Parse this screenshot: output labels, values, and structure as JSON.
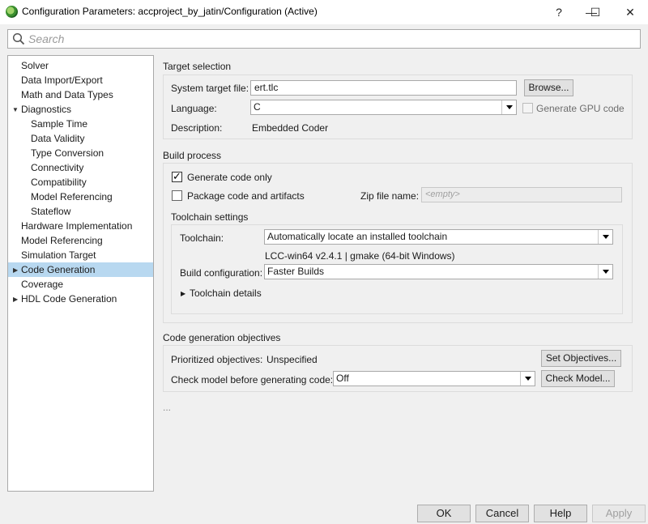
{
  "window": {
    "title": "Configuration Parameters: accproject_by_jatin/Configuration (Active)",
    "help": "?",
    "minimize": "—",
    "maximize": "☐",
    "close": "✕"
  },
  "search": {
    "placeholder": "Search"
  },
  "tree": {
    "items": [
      {
        "label": "Solver"
      },
      {
        "label": "Data Import/Export"
      },
      {
        "label": "Math and Data Types"
      },
      {
        "label": "Diagnostics"
      },
      {
        "label": "Sample Time"
      },
      {
        "label": "Data Validity"
      },
      {
        "label": "Type Conversion"
      },
      {
        "label": "Connectivity"
      },
      {
        "label": "Compatibility"
      },
      {
        "label": "Model Referencing"
      },
      {
        "label": "Stateflow"
      },
      {
        "label": "Hardware Implementation"
      },
      {
        "label": "Model Referencing"
      },
      {
        "label": "Simulation Target"
      },
      {
        "label": "Code Generation"
      },
      {
        "label": "Coverage"
      },
      {
        "label": "HDL Code Generation"
      }
    ],
    "selected": "Code Generation"
  },
  "target_selection": {
    "title": "Target selection",
    "system_target_file_label": "System target file:",
    "system_target_file_value": "ert.tlc",
    "browse_label": "Browse...",
    "language_label": "Language:",
    "language_value": "C",
    "gpu_label": "Generate GPU code",
    "description_label": "Description:",
    "description_value": "Embedded Coder"
  },
  "build_process": {
    "title": "Build process",
    "generate_code_only_label": "Generate code only",
    "package_label": "Package code and artifacts",
    "zip_label": "Zip file name:",
    "zip_placeholder": "<empty>",
    "toolchain_settings_title": "Toolchain settings",
    "toolchain_label": "Toolchain:",
    "toolchain_value": "Automatically locate an installed toolchain",
    "toolchain_info": "LCC-win64 v2.4.1 | gmake (64-bit Windows)",
    "build_config_label": "Build configuration:",
    "build_config_value": "Faster Builds",
    "toolchain_details_label": "Toolchain details"
  },
  "objectives": {
    "title": "Code generation objectives",
    "prioritized_label": "Prioritized objectives:",
    "prioritized_value": "Unspecified",
    "set_objectives_label": "Set Objectives...",
    "check_model_label": "Check model before generating code:",
    "check_model_value": "Off",
    "check_model_button": "Check Model..."
  },
  "ellipsis": "...",
  "footer": {
    "ok": "OK",
    "cancel": "Cancel",
    "help": "Help",
    "apply": "Apply"
  },
  "colors": {
    "selected_bg": "#b8d8f0",
    "window_bg": "#f0f0f0"
  }
}
